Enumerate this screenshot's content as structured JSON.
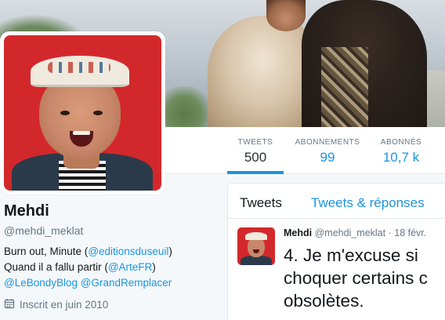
{
  "profile": {
    "name": "Mehdi",
    "handle": "@mehdi_meklat",
    "bio": {
      "line1_prefix": "Burn out, Minute (",
      "line1_link": "@editionsduseuil",
      "line1_suffix": ")",
      "line2_prefix": "Quand il a fallu partir (",
      "line2_link": "@ArteFR",
      "line2_suffix": ")",
      "line3_link1": "@LeBondyBlog",
      "line3_link2": "@GrandRemplacer"
    },
    "joined": "Inscrit en juin 2010",
    "joined_icon": "calendar-icon"
  },
  "nav": {
    "tweets_label": "TWEETS",
    "tweets_value": "500",
    "following_label": "ABONNEMENTS",
    "following_value": "99",
    "followers_label": "ABONNÉS",
    "followers_value": "10,7 k"
  },
  "timeline": {
    "tab_tweets": "Tweets",
    "tab_replies": "Tweets & réponses",
    "tweet": {
      "name": "Mehdi",
      "handle": "@mehdi_meklat",
      "separator": "·",
      "date": "18 févr.",
      "text": "4. Je m'excuse si\nchoquer certains c\nobsolètes."
    }
  },
  "colors": {
    "accent": "#1b95e0",
    "avatar_bg": "#d3282b",
    "secondary_text": "#657786"
  }
}
